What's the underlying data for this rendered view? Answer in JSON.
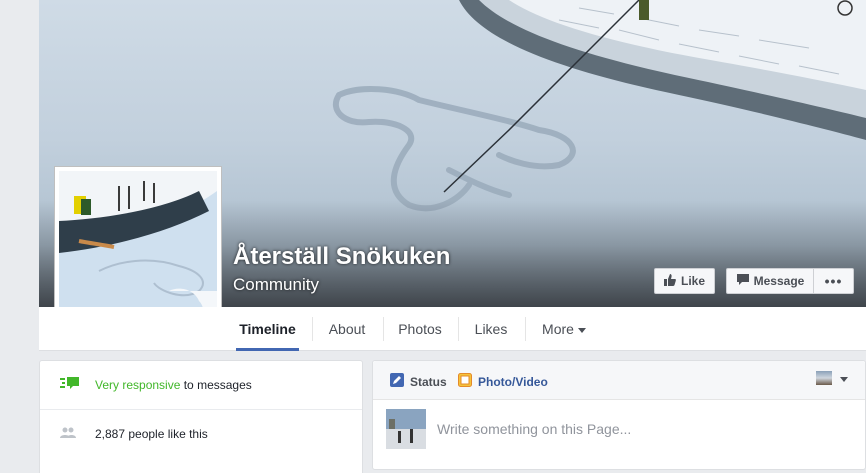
{
  "page": {
    "name": "Återställ Snökuken",
    "category": "Community"
  },
  "actions": {
    "like_label": "Like",
    "message_label": "Message",
    "more_label": "•••"
  },
  "nav": {
    "tabs": [
      {
        "label": "Timeline",
        "active": true
      },
      {
        "label": "About"
      },
      {
        "label": "Photos"
      },
      {
        "label": "Likes"
      },
      {
        "label": "More"
      }
    ]
  },
  "info": {
    "responsiveness_highlight": "Very responsive",
    "responsiveness_rest": " to messages",
    "likes_text": "2,887 people like this"
  },
  "composer": {
    "status_label": "Status",
    "photo_label": "Photo/Video",
    "placeholder": "Write something on this Page..."
  },
  "colors": {
    "brand_blue": "#4267b2",
    "link_blue": "#365899",
    "green": "#42b72a",
    "background": "#e9ebee"
  },
  "icons": {
    "like": "thumbs-up-icon",
    "message": "speech-bubble-icon",
    "responsive": "responsive-chat-icon",
    "people": "people-icon",
    "status": "pencil-icon",
    "photo": "photo-icon",
    "audience": "page-avatar-thumb"
  }
}
